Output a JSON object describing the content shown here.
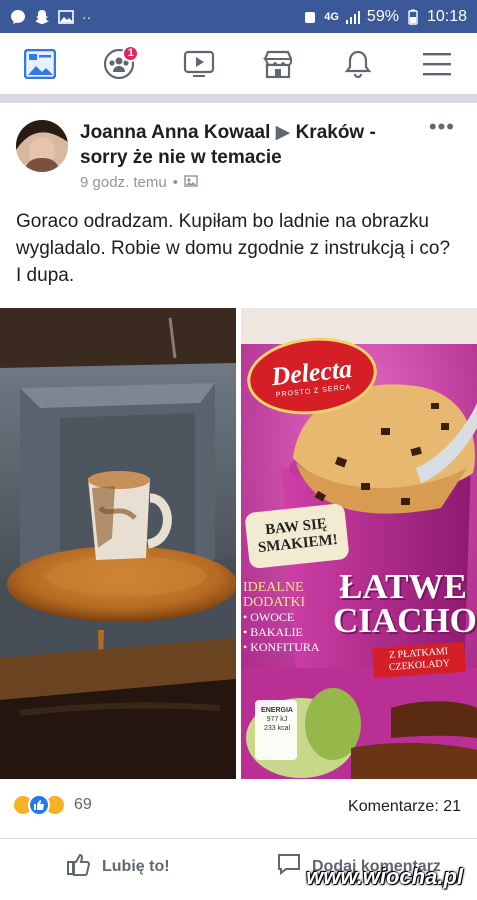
{
  "statusbar": {
    "network": "4G",
    "battery": "59%",
    "time": "10:18"
  },
  "nav": {
    "items": [
      {
        "name": "news-feed-icon"
      },
      {
        "name": "friends-icon",
        "badge": "1"
      },
      {
        "name": "watch-icon"
      },
      {
        "name": "marketplace-icon"
      },
      {
        "name": "notifications-icon"
      },
      {
        "name": "menu-icon"
      }
    ]
  },
  "post": {
    "author": "Joanna Anna Kowaal",
    "group": "Kraków - sorry że nie w temacie",
    "time": "9 godz. temu",
    "text": "Goraco odradzam.  Kupiłam bo ladnie na obrazku wygladalo. Robie w domu zgodnie z instrukcją i co? I dupa.",
    "product": {
      "brand": "Delecta",
      "brand_tagline": "PROSTO Z SERCA",
      "burst": "BAW SIĘ SMAKIEM!",
      "side_text": [
        "IDEALNE",
        "DODATKI",
        "• OWOCE",
        "• BAKALIE",
        "• KONFITURA"
      ],
      "name_line1": "ŁATWE",
      "name_line2": "CIACHO",
      "variant_line1": "Z PŁATKAMI",
      "variant_line2": "CZEKOLADY",
      "energy_label": "ENERGIA",
      "energy_value1": "977 kJ",
      "energy_value2": "233 kcal"
    },
    "reactions_count": "69",
    "comments": "Komentarze: 21",
    "like_label": "Lubię to!",
    "comment_label": "Dodaj komentarz"
  },
  "watermark": "www.wiocha.pl",
  "colors": {
    "fb_blue": "#3b5998",
    "nav_icon": "#3578e5",
    "badge": "#e0245e",
    "package_pink": "#c23aa0"
  }
}
